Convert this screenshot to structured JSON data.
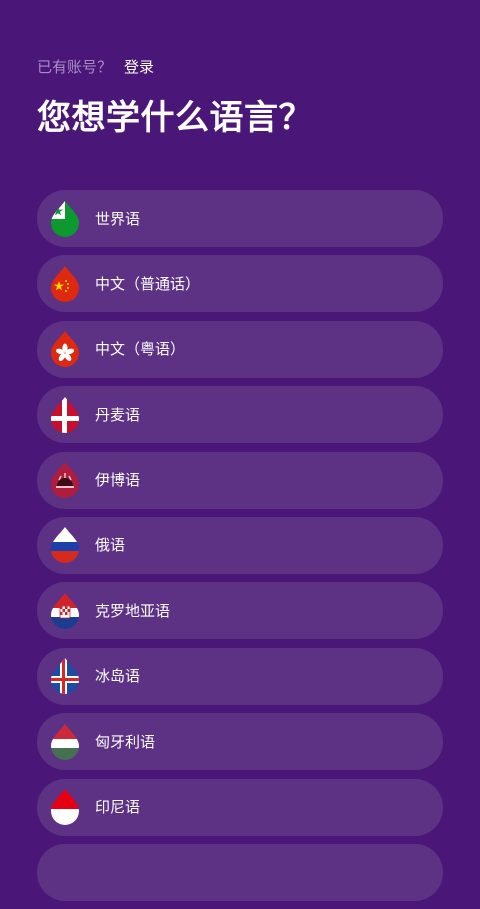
{
  "header": {
    "login_prompt": "已有账号？",
    "login_link": "登录",
    "title": "您想学什么语言？"
  },
  "languages": [
    {
      "label": "世界语",
      "flag": "esperanto-flag-icon"
    },
    {
      "label": "中文（普通话）",
      "flag": "china-flag-icon"
    },
    {
      "label": "中文（粤语）",
      "flag": "hong-kong-flag-icon"
    },
    {
      "label": "丹麦语",
      "flag": "denmark-flag-icon"
    },
    {
      "label": "伊博语",
      "flag": "igbo-flag-icon"
    },
    {
      "label": "俄语",
      "flag": "russia-flag-icon"
    },
    {
      "label": "克罗地亚语",
      "flag": "croatia-flag-icon"
    },
    {
      "label": "冰岛语",
      "flag": "iceland-flag-icon"
    },
    {
      "label": "匈牙利语",
      "flag": "hungary-flag-icon"
    },
    {
      "label": "印尼语",
      "flag": "indonesia-flag-icon"
    },
    {
      "label": "",
      "flag": ""
    }
  ],
  "colors": {
    "background": "#4a1778",
    "item_background": "#5d3184",
    "prompt_text": "#a98cc4"
  }
}
